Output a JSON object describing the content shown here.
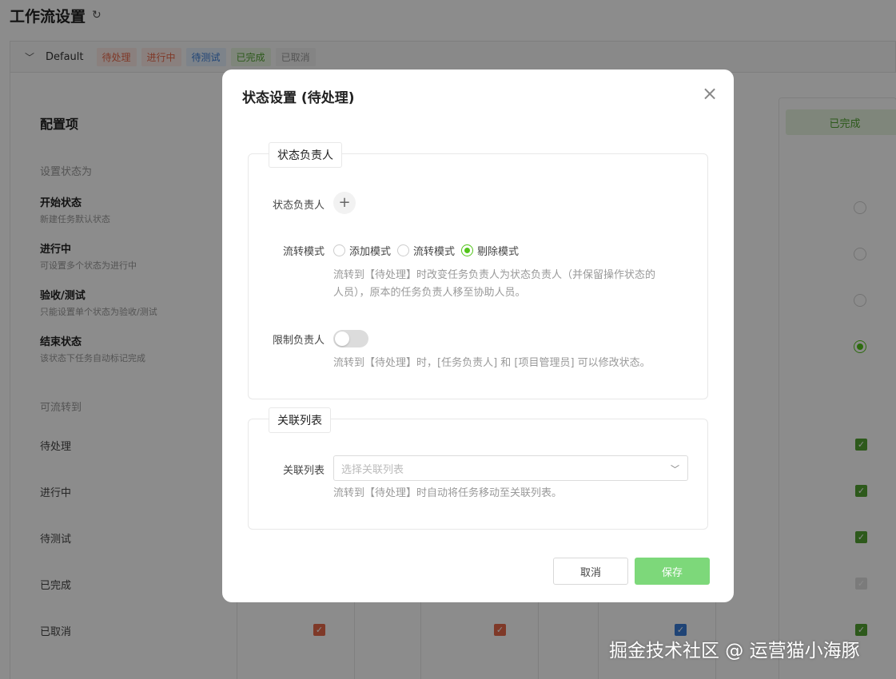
{
  "page": {
    "title": "工作流设置",
    "refresh_icon": "refresh-icon"
  },
  "group_bar": {
    "name": "Default",
    "chips": [
      {
        "label": "待处理",
        "color": "#e8684a",
        "bg": "#fbe9e5"
      },
      {
        "label": "进行中",
        "color": "#e8684a",
        "bg": "#fbe9e5"
      },
      {
        "label": "待测试",
        "color": "#3a7dd8",
        "bg": "#e4eefb"
      },
      {
        "label": "已完成",
        "color": "#52a332",
        "bg": "#e8f5e1"
      },
      {
        "label": "已取消",
        "color": "#999999",
        "bg": "#f0f0f0"
      }
    ]
  },
  "config": {
    "title": "配置项",
    "set_status_label": "设置状态为",
    "status_types": [
      {
        "name": "开始状态",
        "desc": "新建任务默认状态"
      },
      {
        "name": "进行中",
        "desc": "可设置多个状态为进行中"
      },
      {
        "name": "验收/测试",
        "desc": "只能设置单个状态为验收/测试"
      },
      {
        "name": "结束状态",
        "desc": "该状态下任务自动标记完成"
      }
    ],
    "flow_to_label": "可流转到",
    "flow_targets": [
      "待处理",
      "进行中",
      "待测试",
      "已完成",
      "已取消"
    ]
  },
  "visible_column": {
    "header": "已完成",
    "header_color": "#52a332",
    "header_bg": "#e8f5e1",
    "status_radio_selected_index": 3,
    "flow_checked": [
      true,
      true,
      true,
      false,
      true
    ]
  },
  "bottom_checkboxes": [
    {
      "checked": true,
      "color": "#e8684a"
    },
    {
      "checked": true,
      "color": "#e8684a"
    },
    {
      "checked": true,
      "color": "#3a7dd8"
    },
    {
      "checked": true,
      "color": "#52a332"
    }
  ],
  "modal": {
    "title": "状态设置 (待处理)",
    "assignee_section": {
      "legend": "状态负责人",
      "assignee_label": "状态负责人",
      "flow_mode_label": "流转模式",
      "flow_modes": [
        {
          "label": "添加模式",
          "selected": false
        },
        {
          "label": "流转模式",
          "selected": false
        },
        {
          "label": "剔除模式",
          "selected": true
        }
      ],
      "flow_mode_help_1": "流转到【待处理】时改变任务负责人为状态负责人（并保留操作状态的",
      "flow_mode_help_2": "人员），原本的任务负责人移至协助人员。",
      "limit_label": "限制负责人",
      "limit_enabled": false,
      "limit_help": "流转到【待处理】时，[任务负责人] 和 [项目管理员] 可以修改状态。"
    },
    "list_section": {
      "legend": "关联列表",
      "list_label": "关联列表",
      "list_placeholder": "选择关联列表",
      "list_help": "流转到【待处理】时自动将任务移动至关联列表。"
    },
    "cancel_label": "取消",
    "save_label": "保存",
    "accent": "#52c41a"
  },
  "watermark": "掘金技术社区 @ 运营猫小海豚"
}
